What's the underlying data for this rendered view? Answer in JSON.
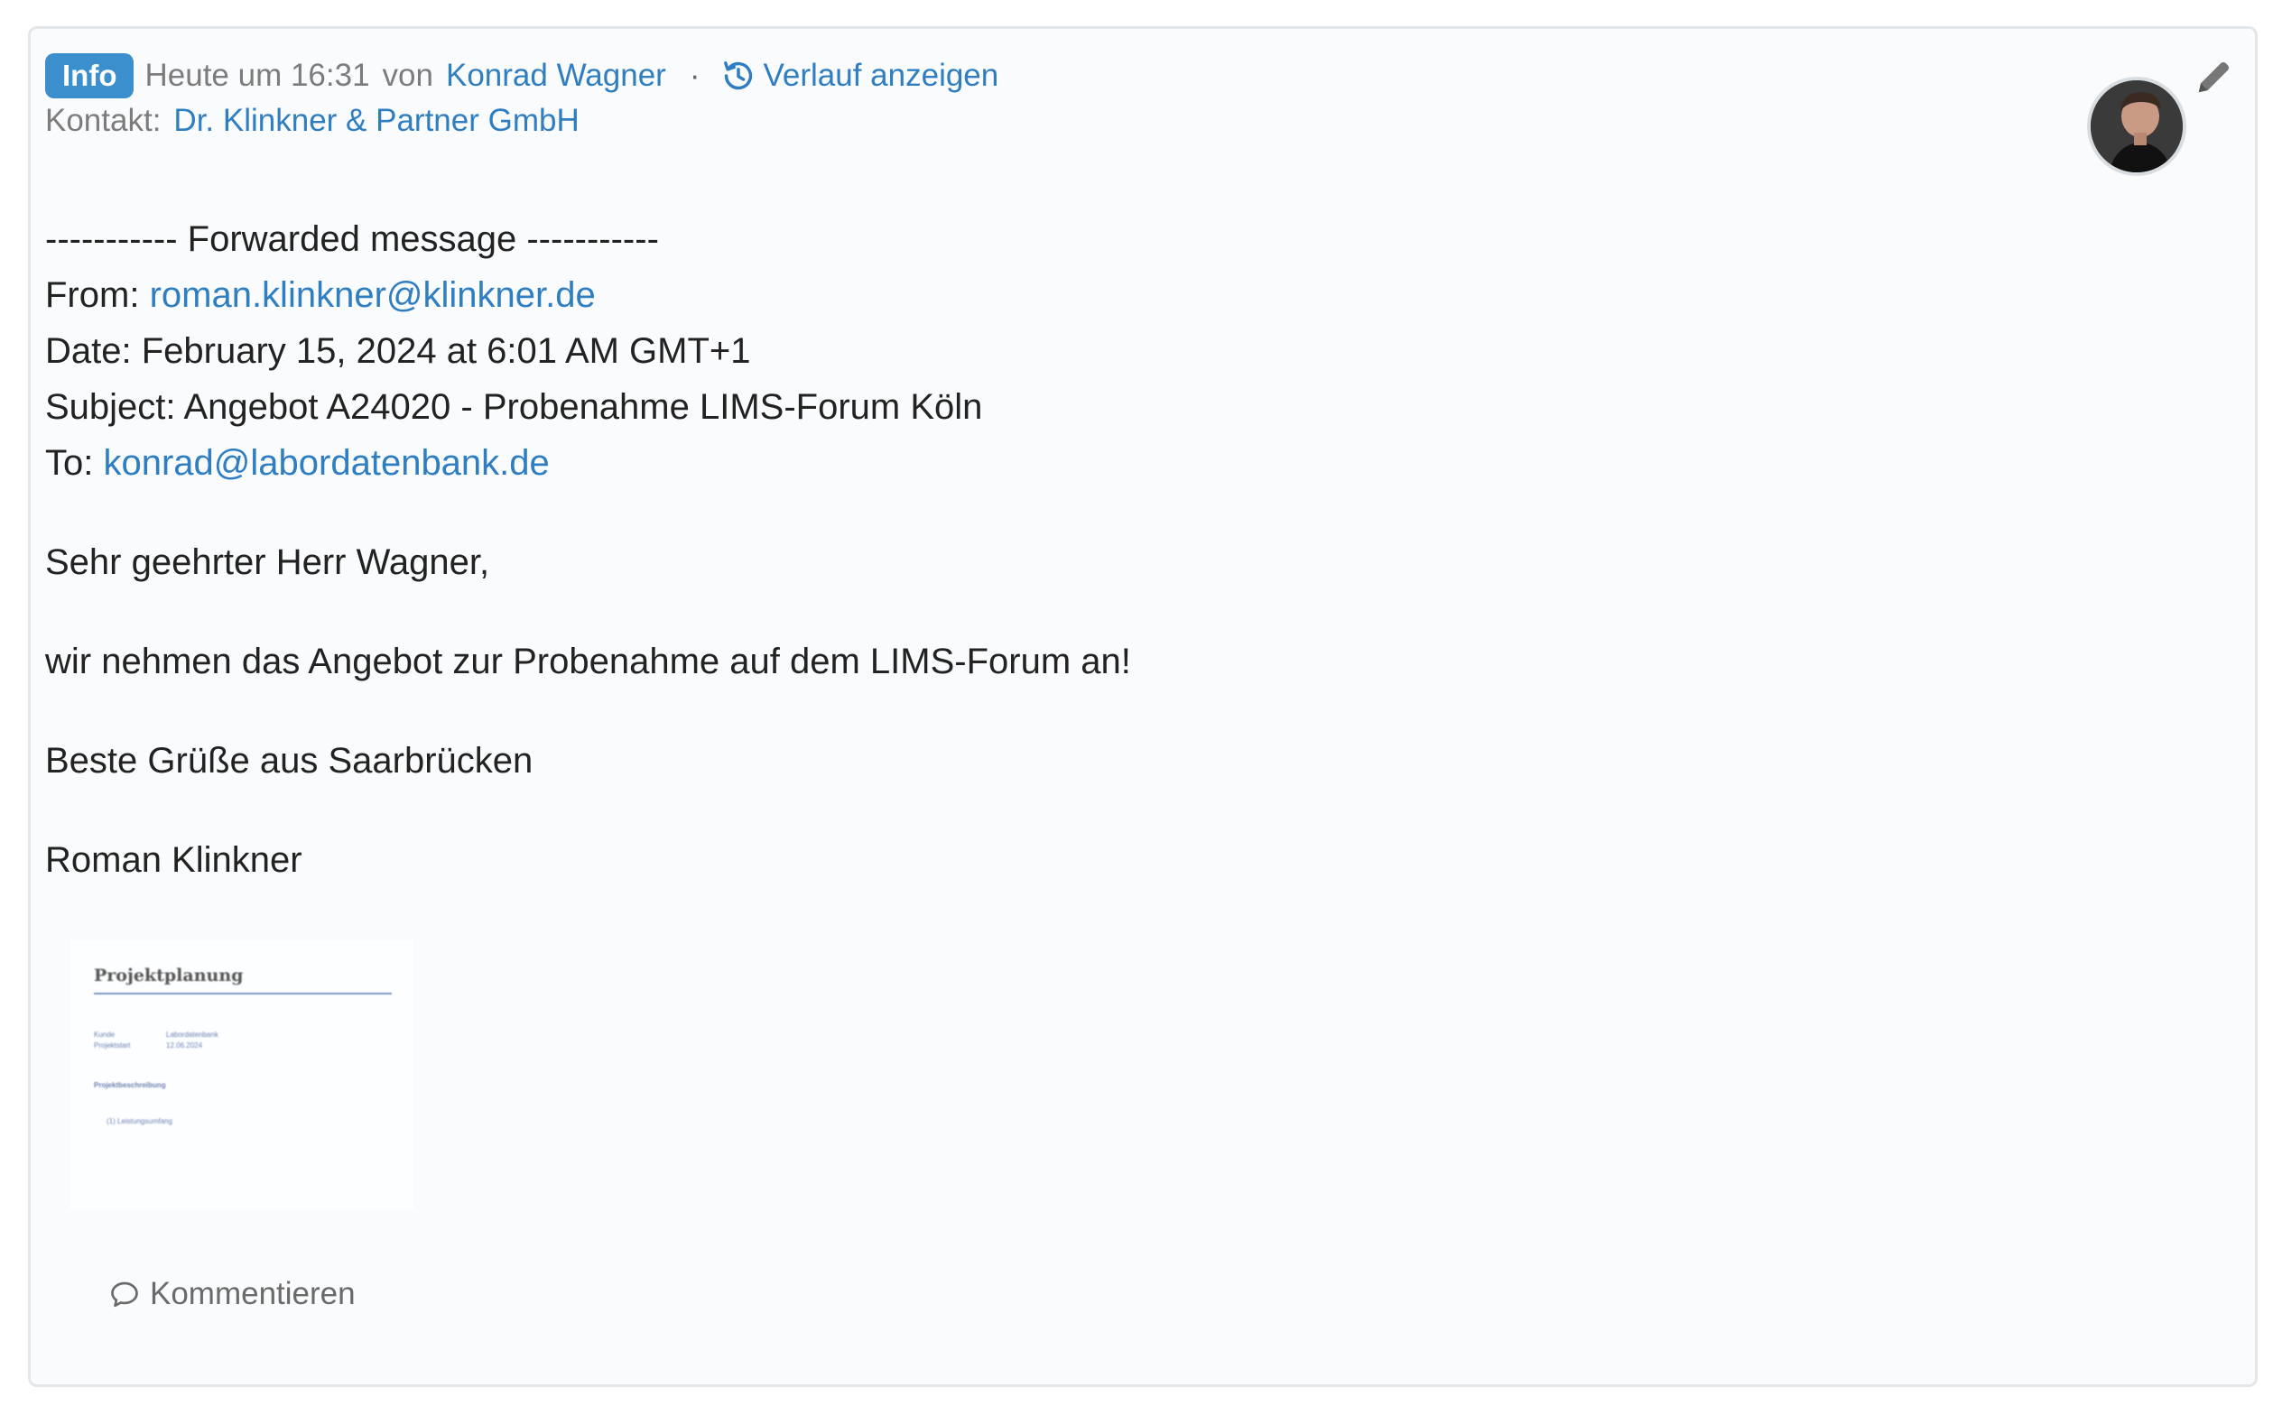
{
  "header": {
    "badge": "Info",
    "timestamp": "Heute um 16:31",
    "by_label": "von",
    "author": "Konrad Wagner",
    "separator": "·",
    "history_link": "Verlauf anzeigen",
    "contact_label": "Kontakt:",
    "contact_name": "Dr. Klinkner & Partner GmbH"
  },
  "message": {
    "forward_header": "----------- Forwarded message -----------",
    "from_label": "From:",
    "from_email": "roman.klinkner@klinkner.de",
    "date_line": "Date: February 15, 2024 at 6:01 AM GMT+1",
    "subject_line": "Subject: Angebot A24020 - Probenahme LIMS-Forum Köln",
    "to_label": "To:",
    "to_email": "konrad@labordatenbank.de",
    "greeting": "Sehr geehrter Herr Wagner,",
    "body": "wir nehmen das Angebot zur Probenahme auf dem LIMS-Forum an!",
    "closing": "Beste Grüße aus Saarbrücken",
    "signature": "Roman Klinkner"
  },
  "attachment": {
    "title": "Projektplanung",
    "line1_label": "Kunde",
    "line1_value": "Labordatenbank",
    "line2_label": "Projektstart",
    "line2_value": "12.06.2024",
    "section": "Projektbeschreibung",
    "item": "(1) Leistungsumfang"
  },
  "actions": {
    "comment": "Kommentieren"
  },
  "colors": {
    "accent": "#3b8fcd",
    "link": "#2f7ec2",
    "muted": "#7c7c7c",
    "card_bg": "#f9fbfc"
  },
  "icons": [
    "history-icon",
    "pencil-icon",
    "comment-icon"
  ]
}
